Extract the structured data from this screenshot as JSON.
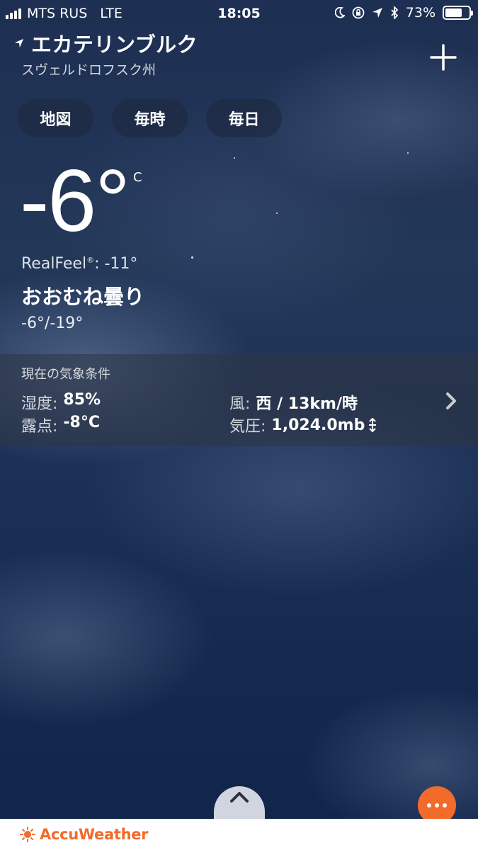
{
  "status_bar": {
    "carrier": "MTS RUS",
    "network": "LTE",
    "time": "18:05",
    "battery": "73%",
    "battery_level": 0.73,
    "icons": [
      "moon-icon",
      "rotation-lock-icon",
      "location-arrow-icon",
      "bluetooth-icon",
      "battery-icon"
    ]
  },
  "location": {
    "city": "エカテリンブルク",
    "region": "スヴェルドロフスク州"
  },
  "tabs": [
    {
      "label": "地図"
    },
    {
      "label": "毎時"
    },
    {
      "label": "毎日"
    }
  ],
  "current": {
    "temperature": "-6°",
    "unit": "C",
    "realfeel_label": "RealFeel",
    "realfeel_mark": "®",
    "realfeel_value": ": -11°",
    "condition": "おおむね曇り",
    "high_low": "-6°/-19°"
  },
  "conditions_panel": {
    "title": "現在の気象条件",
    "humidity_label": "湿度:",
    "humidity_value": "85%",
    "dewpoint_label": "露点:",
    "dewpoint_value": "-8°C",
    "wind_label": "風:",
    "wind_value": "西 / 13km/時",
    "pressure_label": "気圧:",
    "pressure_value": "1,024.0mb"
  },
  "footer": {
    "brand": "AccuWeather",
    "brand_color": "#f26b2b"
  },
  "colors": {
    "accent": "#f26b2b",
    "tab_bg": "#1e2a42"
  }
}
